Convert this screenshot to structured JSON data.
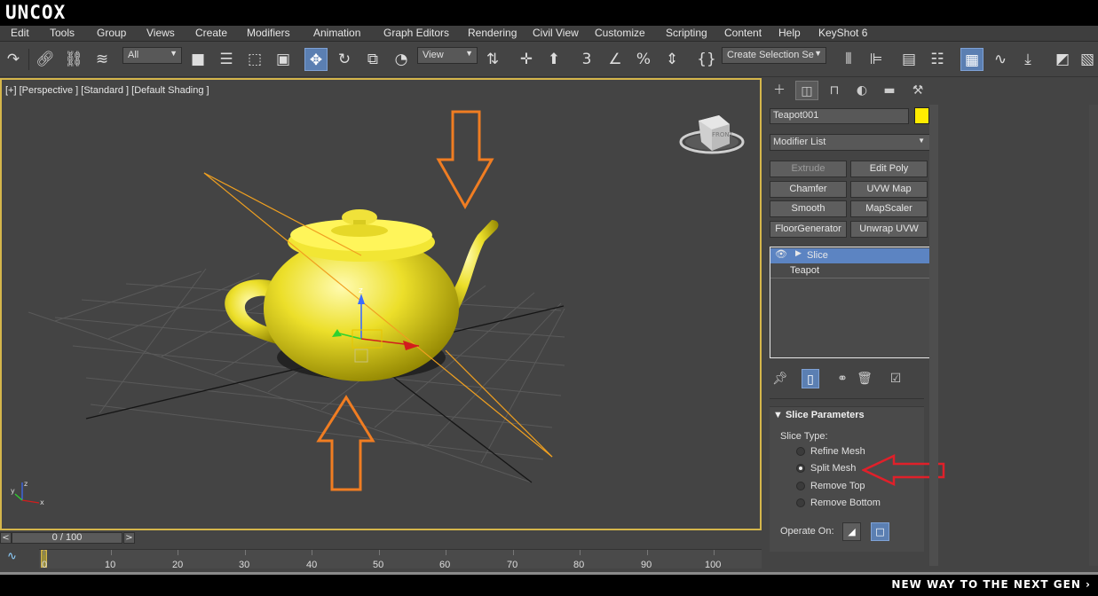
{
  "brand": "UNCOX",
  "menu": [
    "Edit",
    "Tools",
    "Group",
    "Views",
    "Create",
    "Modifiers",
    "Animation",
    "Graph Editors",
    "Rendering",
    "Civil View",
    "Customize",
    "Scripting",
    "Content",
    "Help",
    "KeyShot 6"
  ],
  "toolbar": {
    "filter_value": "All",
    "coord_value": "View",
    "selection_set_value": "Create Selection Se",
    "snap_label": "3",
    "angle_snap_label": "∠",
    "percent_snap_label": "%"
  },
  "viewport": {
    "label": "[+] [Perspective ] [Standard ] [Default Shading ]",
    "viewcube_label": "FRONT",
    "axis_z": "z",
    "axis_x": "x",
    "axis_y": "y"
  },
  "command_panel": {
    "object_name": "Teapot001",
    "object_color": "#ffec00",
    "modifier_list": "Modifier List",
    "modifier_buttons": [
      "Extrude",
      "Edit Poly",
      "Chamfer",
      "UVW Map",
      "Smooth",
      "MapScaler",
      "FloorGenerator",
      "Unwrap UVW"
    ],
    "stack": [
      "Slice",
      "Teapot"
    ],
    "rollout_title": "Slice Parameters",
    "slice_type_label": "Slice Type:",
    "slice_types": [
      "Refine Mesh",
      "Split Mesh",
      "Remove Top",
      "Remove Bottom"
    ],
    "selected_slice_type": "Split Mesh",
    "operate_on_label": "Operate On:"
  },
  "timeline": {
    "slider_text": "0 / 100",
    "prev": "<",
    "next": ">",
    "ticks": [
      "0",
      "10",
      "20",
      "30",
      "40",
      "50",
      "60",
      "70",
      "80",
      "90",
      "100"
    ]
  },
  "footer": {
    "tagline": "NEW WAY TO THE NEXT GEN ›"
  },
  "annotations": {
    "arrow_color_orange": "#f07d22",
    "arrow_color_red": "#e0202a"
  }
}
